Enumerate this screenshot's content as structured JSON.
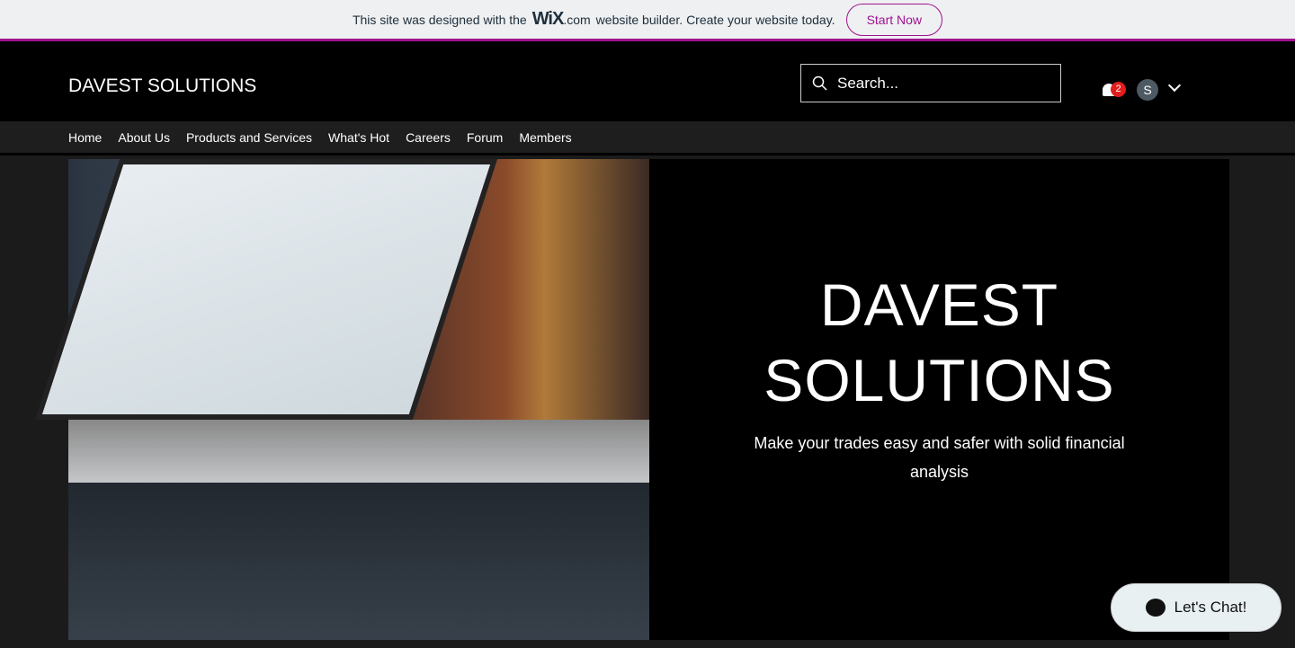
{
  "banner": {
    "text_before": "This site was designed with the",
    "brand": "WiX",
    "brand_suffix": ".com",
    "text_after": "website builder. Create your website today.",
    "cta": "Start Now",
    "accent": "#a0138e"
  },
  "header": {
    "logo": "DAVEST SOLUTIONS",
    "search_placeholder": "Search...",
    "notifications": "2",
    "avatar_initial": "S"
  },
  "nav": {
    "items": [
      "Home",
      "About Us",
      "Products and Services",
      "What's Hot",
      "Careers",
      "Forum",
      "Members"
    ]
  },
  "hero": {
    "title": "DAVEST SOLUTIONS",
    "subtitle": "Make your trades easy and safer with solid financial analysis"
  },
  "chat": {
    "label": "Let's Chat!"
  }
}
